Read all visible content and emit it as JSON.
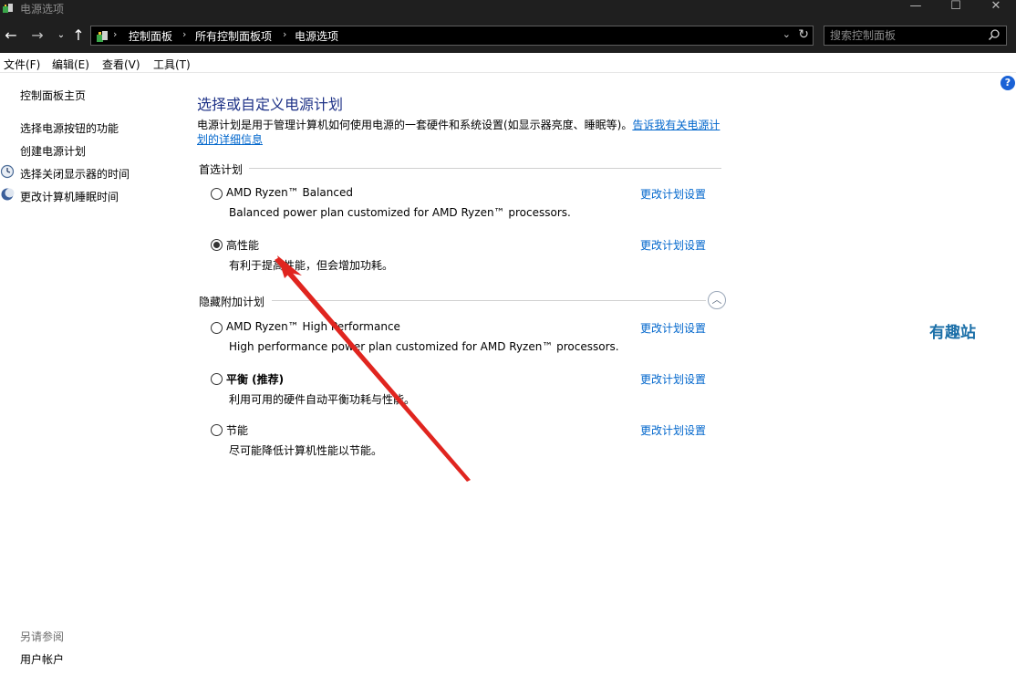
{
  "window": {
    "title": "电源选项",
    "minimize_glyph": "—",
    "maximize_glyph": "☐",
    "close_glyph": "✕"
  },
  "navigation": {
    "back_glyph": "←",
    "forward_glyph": "→",
    "recent_glyph": "⌄",
    "up_glyph": "↑",
    "breadcrumbs": [
      "控制面板",
      "所有控制面板项",
      "电源选项"
    ],
    "separator": "›",
    "dropdown_glyph": "⌄",
    "refresh_glyph": "↻",
    "search_placeholder": "搜索控制面板"
  },
  "menubar": {
    "items": [
      "文件(F)",
      "编辑(E)",
      "查看(V)",
      "工具(T)"
    ]
  },
  "sidebar": {
    "home": "控制面板主页",
    "links": [
      "选择电源按钮的功能",
      "创建电源计划",
      "选择关闭显示器的时间",
      "更改计算机睡眠时间"
    ],
    "see_also_title": "另请参阅",
    "see_also_links": [
      "用户帐户"
    ]
  },
  "main": {
    "title": "选择或自定义电源计划",
    "description": "电源计划是用于管理计算机如何使用电源的一套硬件和系统设置(如显示器亮度、睡眠等)。",
    "description_link": "告诉我有关电源计划的详细信息",
    "preferred_section": "首选计划",
    "hidden_section": "隐藏附加计划",
    "collapse_glyph": "︿",
    "change_settings_label": "更改计划设置",
    "plans": [
      {
        "name": "AMD Ryzen™ Balanced",
        "description": "Balanced power plan customized for AMD Ryzen™ processors.",
        "selected": false,
        "bold": false
      },
      {
        "name": "高性能",
        "description": "有利于提高性能，但会增加功耗。",
        "selected": true,
        "bold": false
      },
      {
        "name": "AMD Ryzen™ High Performance",
        "description": "High performance power plan customized for AMD Ryzen™ processors.",
        "selected": false,
        "bold": false
      },
      {
        "name": "平衡 (推荐)",
        "description": "利用可用的硬件自动平衡功耗与性能。",
        "selected": false,
        "bold": true
      },
      {
        "name": "节能",
        "description": "尽可能降低计算机性能以节能。",
        "selected": false,
        "bold": false
      }
    ]
  },
  "help_glyph": "?",
  "watermark": "有趣站",
  "colors": {
    "title_blue": "#1e3287",
    "link_blue": "#0066cc",
    "annotation_red": "#e0251f"
  }
}
